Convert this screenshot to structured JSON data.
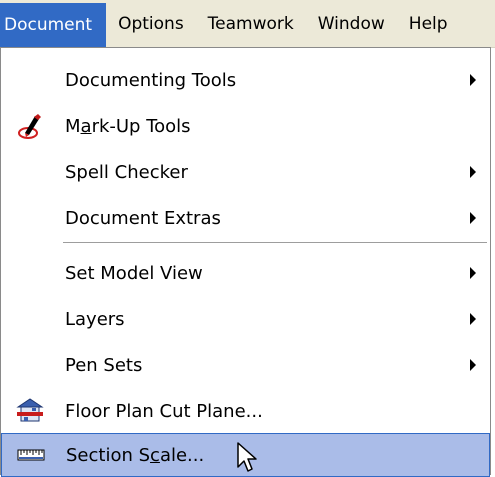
{
  "menubar": {
    "items": [
      {
        "label": "Document",
        "active": true
      },
      {
        "label": "Options",
        "active": false
      },
      {
        "label": "Teamwork",
        "active": false
      },
      {
        "label": "Window",
        "active": false
      },
      {
        "label": "Help",
        "active": false
      }
    ]
  },
  "menu": {
    "items": [
      {
        "label": "Documenting Tools",
        "submenu": true,
        "icon": null
      },
      {
        "label_pre": "M",
        "label_mn": "a",
        "label_post": "rk-Up Tools",
        "submenu": false,
        "icon": "markup-pen-icon"
      },
      {
        "label": "Spell Checker",
        "submenu": true,
        "icon": null
      },
      {
        "label": "Document Extras",
        "submenu": true,
        "icon": null
      },
      {
        "label": "Set Model View",
        "submenu": true,
        "icon": null
      },
      {
        "label": "Layers",
        "submenu": true,
        "icon": null
      },
      {
        "label": "Pen Sets",
        "submenu": true,
        "icon": null
      },
      {
        "label": "Floor Plan Cut Plane...",
        "submenu": false,
        "icon": "floor-plan-cut-plane-icon"
      },
      {
        "label_pre": "Section S",
        "label_mn": "c",
        "label_post": "ale...",
        "submenu": false,
        "icon": "ruler-icon",
        "highlighted": true
      }
    ]
  },
  "colors": {
    "highlight_bg": "#aabce8",
    "highlight_border": "#316ac5",
    "menubar_active": "#316ac5"
  }
}
